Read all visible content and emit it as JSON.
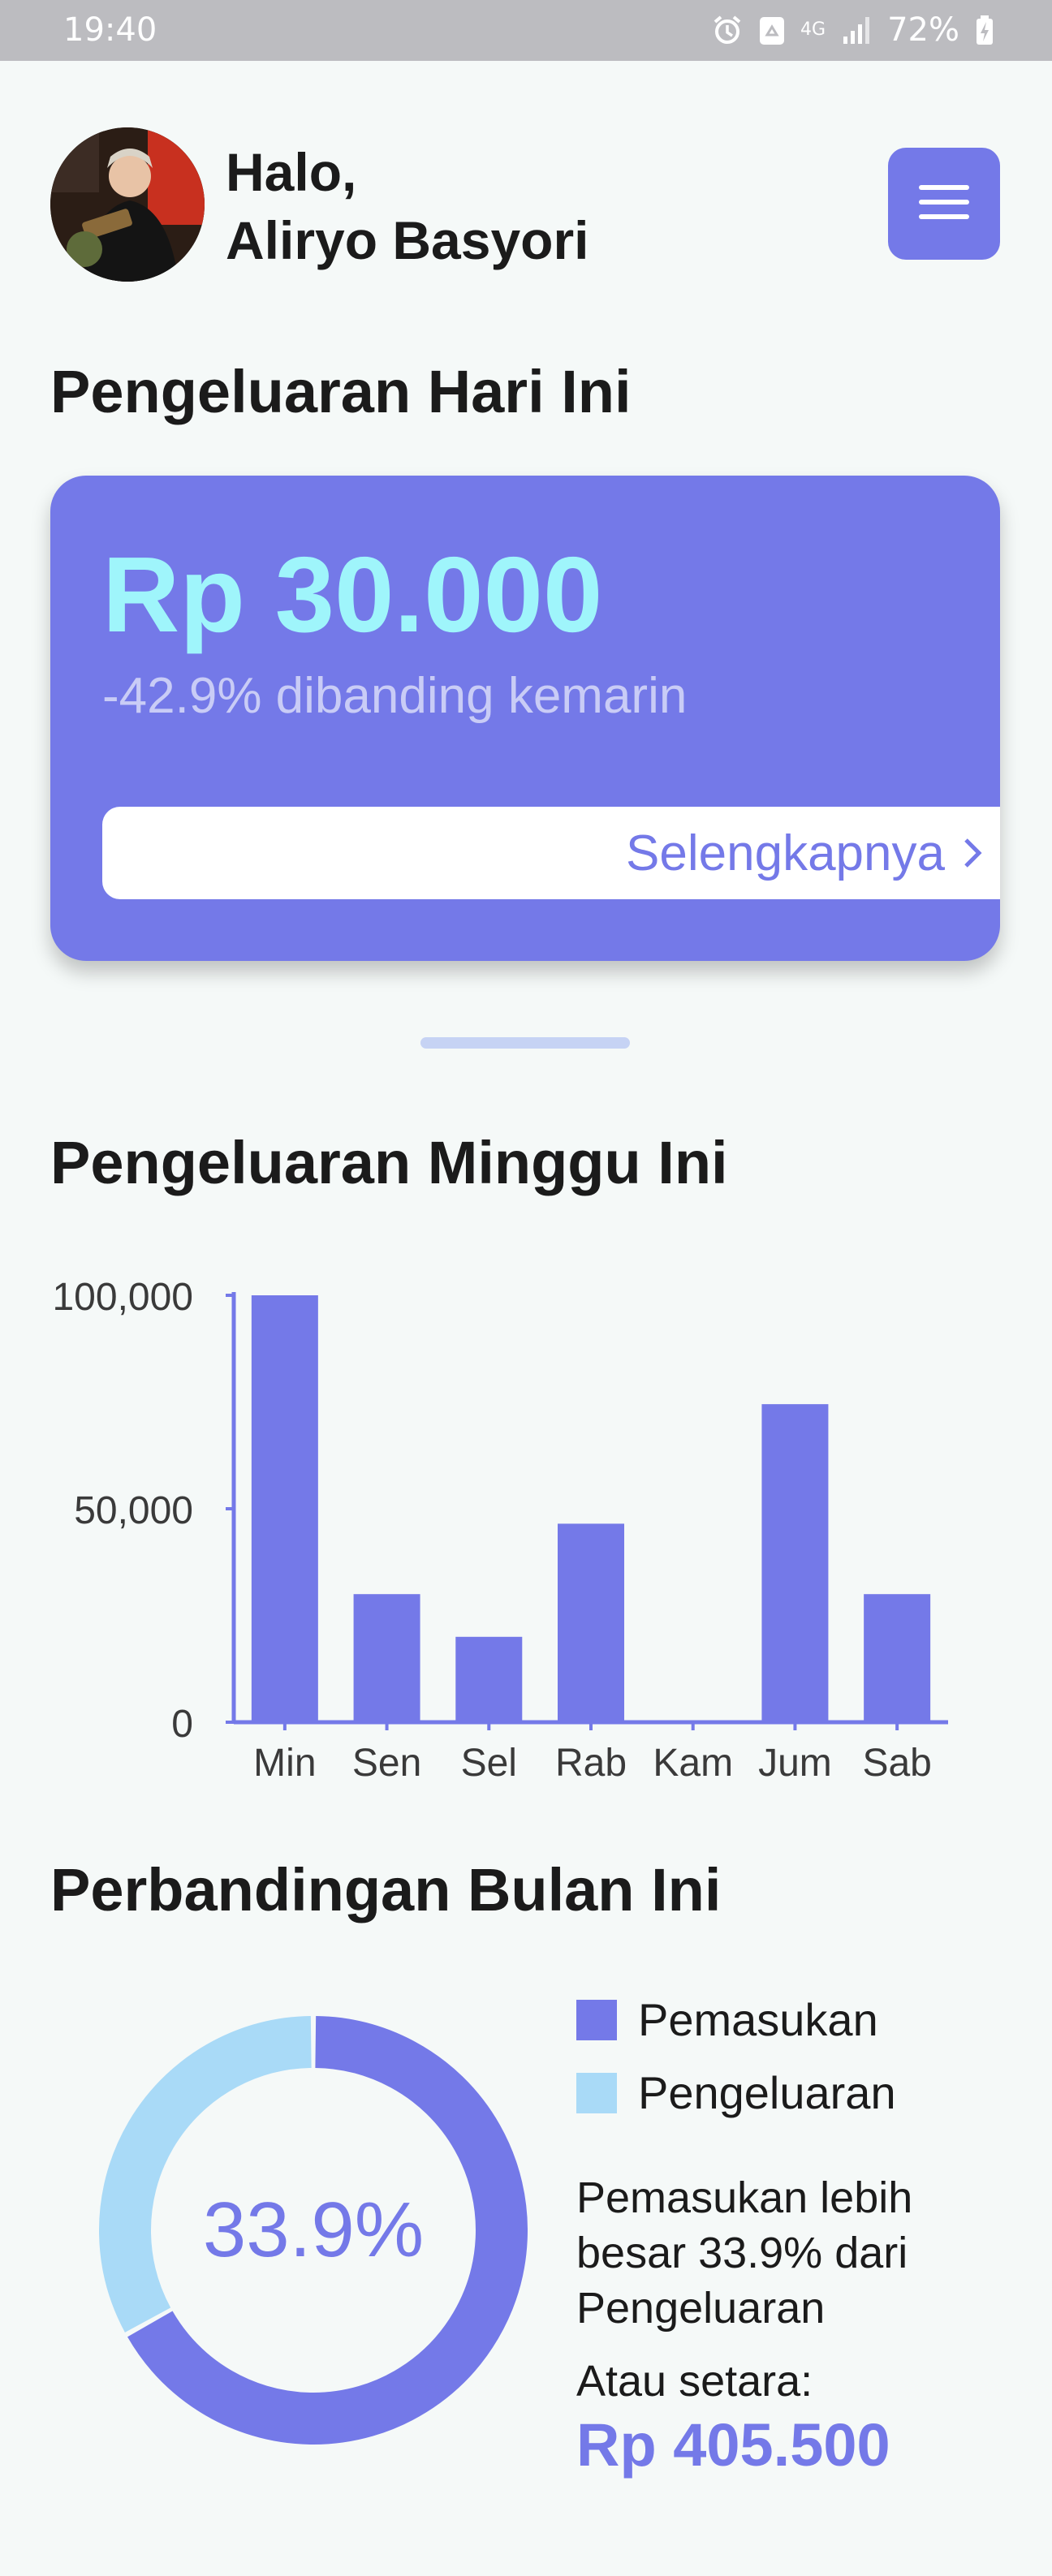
{
  "status_bar": {
    "time": "19:40",
    "network": "4G",
    "battery": "72%",
    "icons": [
      "alarm-icon",
      "recycle-icon",
      "network-icon",
      "signal-icon",
      "battery-charging-icon"
    ]
  },
  "header": {
    "greeting_line1": "Halo,",
    "user_name": "Aliryo Basyori",
    "menu_icon": "hamburger-icon"
  },
  "today": {
    "title": "Pengeluaran Hari Ini",
    "amount": "Rp 30.000",
    "comparison": "-42.9% dibanding kemarin",
    "more_label": "Selengkapnya"
  },
  "week": {
    "title": "Pengeluaran Minggu Ini"
  },
  "chart_data": {
    "type": "bar",
    "categories": [
      "Min",
      "Sen",
      "Sel",
      "Rab",
      "Kam",
      "Jum",
      "Sab"
    ],
    "values": [
      100000,
      30000,
      20000,
      46500,
      0,
      74500,
      30000
    ],
    "yticks": [
      "0",
      "50,000",
      "100,000"
    ],
    "ylim": [
      0,
      100000
    ],
    "color": "#7479e8"
  },
  "month": {
    "title": "Perbandingan Bulan Ini",
    "percent_label": "33.9%",
    "income_fraction": 0.669,
    "legend": [
      {
        "label": "Pemasukan",
        "color": "#7479e8"
      },
      {
        "label": "Pengeluaran",
        "color": "#a9daf7"
      }
    ],
    "comparison_text": "Pemasukan lebih besar 33.9% dari Pengeluaran",
    "equivalent_label": "Atau setara:",
    "equivalent_value": "Rp 405.500"
  }
}
